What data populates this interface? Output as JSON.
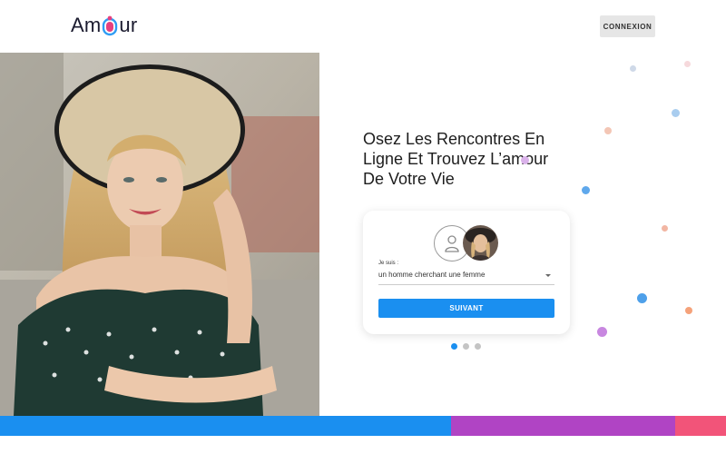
{
  "header": {
    "logo_text_start": "Am",
    "logo_text_end": "ur",
    "login_label": "CONNEXION"
  },
  "hero": {
    "headline_line1": "Osez Les Rencontres En",
    "headline_line2": "Ligne Et Trouvez L’amour",
    "headline_line3": "De Votre Vie"
  },
  "form": {
    "field_label": "Je suis :",
    "select_value": "un homme cherchant une femme",
    "next_label": "SUIVANT",
    "step_current": 1,
    "step_total": 3
  },
  "colors": {
    "primary_blue": "#1a8ff0",
    "purple": "#b044c4",
    "pink": "#f25479",
    "logo_pink": "#e6407f",
    "logo_blue": "#2e9cf4"
  },
  "icons": {
    "avatar_placeholder": "user-outline-icon",
    "select_caret": "chevron-down-icon"
  }
}
